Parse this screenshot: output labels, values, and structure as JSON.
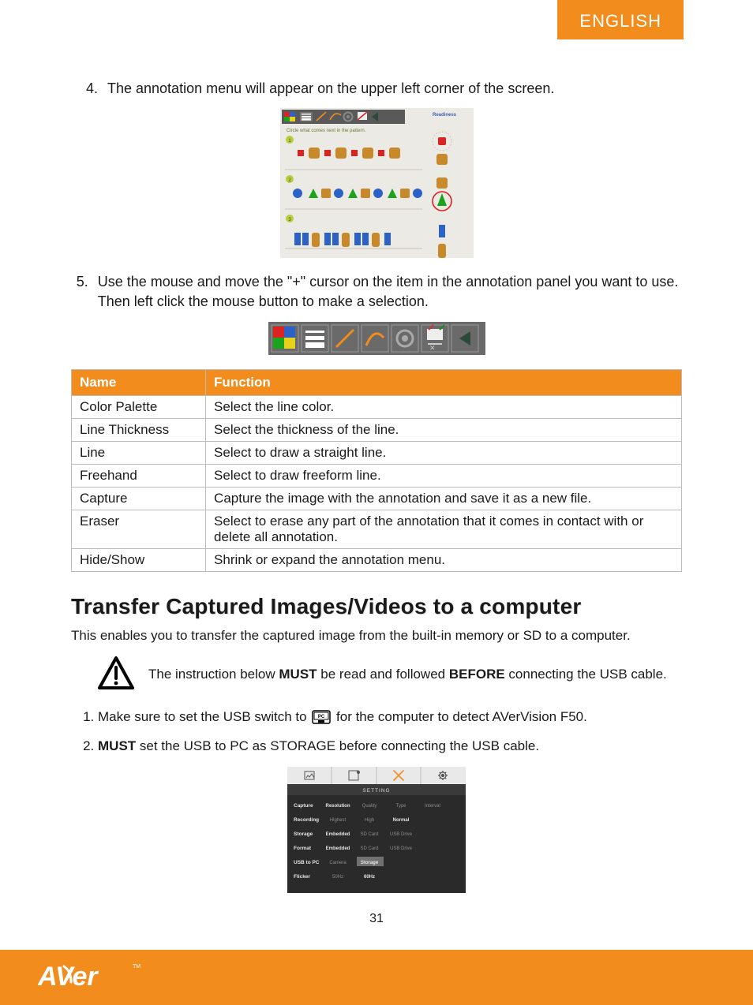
{
  "tab": {
    "label": "ENGLISH"
  },
  "steps_a": [
    {
      "num": "4.",
      "text": "The annotation menu will appear on the upper left corner of the screen."
    },
    {
      "num": "5.",
      "text": "Use the mouse and move the \"+\" cursor on the item in the annotation panel you want to use. Then left click the mouse button to make a selection."
    }
  ],
  "fn_table": {
    "headers": [
      "Name",
      "Function"
    ],
    "rows": [
      [
        "Color Palette",
        "Select the line color."
      ],
      [
        "Line Thickness",
        "Select the thickness of the line."
      ],
      [
        "Line",
        "Select to draw a straight line."
      ],
      [
        "Freehand",
        "Select to draw freeform line."
      ],
      [
        "Capture",
        "Capture the image with the annotation and save it as a new file."
      ],
      [
        "Eraser",
        "Select to erase any part of the annotation that it comes in contact with or delete all annotation."
      ],
      [
        "Hide/Show",
        "Shrink or expand the annotation menu."
      ]
    ]
  },
  "transfer_heading": "Transfer Captured Images/Videos to a computer",
  "transfer_intro": "This enables you to transfer the captured image from the built-in memory or SD to a computer.",
  "warning": {
    "pre": "The instruction below ",
    "b1": "MUST",
    "mid": " be read and followed ",
    "b2": "BEFORE",
    "post": " connecting the USB cable."
  },
  "steps_b": [
    {
      "pre": "Make sure to set the USB switch to ",
      "post": " for the computer to detect AVerVision F50."
    },
    {
      "b": "MUST",
      "rest": " set the USB to PC as STORAGE before connecting the USB cable."
    }
  ],
  "settings_panel": {
    "title": "SETTING",
    "rows": [
      {
        "label": "Capture",
        "cells": [
          "Resolution",
          "Quality",
          "Type",
          "Interval"
        ]
      },
      {
        "label": "Recording",
        "cells": [
          "Highest",
          "High",
          "Normal",
          ""
        ]
      },
      {
        "label": "Storage",
        "cells": [
          "Embedded",
          "SD Card",
          "USB Drive",
          ""
        ]
      },
      {
        "label": "Format",
        "cells": [
          "Embedded",
          "SD Card",
          "USB Drive",
          ""
        ]
      },
      {
        "label": "USB to PC",
        "cells": [
          "Camera",
          "Storage",
          "",
          ""
        ]
      },
      {
        "label": "Flicker",
        "cells": [
          "50Hz",
          "60Hz",
          "",
          ""
        ]
      }
    ]
  },
  "page_number": "31",
  "annot_caption": "Circle what comes next in the pattern.",
  "readiness": "Readiness",
  "pc_badge": "PC"
}
